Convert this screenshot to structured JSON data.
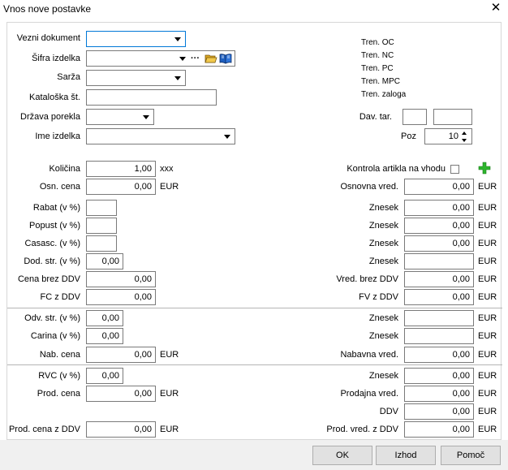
{
  "window": {
    "title": "Vnos nove postavke"
  },
  "header": {
    "vezni_dokument": "Vezni dokument",
    "sifra_izdelka": "Šifra izdelka",
    "sarza": "Sarža",
    "kataloska": "Kataloška št.",
    "drzava": "Država porekla",
    "ime_izdelka": "Ime izdelka",
    "tren_oc": "Tren. OC",
    "tren_nc": "Tren. NC",
    "tren_pc": "Tren. PC",
    "tren_mpc": "Tren. MPC",
    "tren_zaloga": "Tren. zaloga",
    "dav_tar": "Dav. tar.",
    "poz": "Poz",
    "poz_value": "10",
    "dots": "···"
  },
  "main": {
    "kolicina": "Količina",
    "kolicina_value": "1,00",
    "kolicina_unit": "xxx",
    "kontrola": "Kontrola artikla na vhodu",
    "osn_cena": "Osn. cena",
    "osn_cena_value": "0,00",
    "osnovna_vred": "Osnovna vred.",
    "osnovna_vred_value": "0,00",
    "rabat": "Rabat (v %)",
    "popust": "Popust (v %)",
    "casasc": "Casasc. (v %)",
    "dod_str": "Dod. str. (v %)",
    "dod_str_value": "0,00",
    "znesek": "Znesek",
    "znesek_value": "0,00",
    "cena_brez_ddv": "Cena brez DDV",
    "cena_brez_ddv_value": "0,00",
    "vred_brez_ddv": "Vred. brez DDV",
    "vred_brez_ddv_value": "0,00",
    "fc_z_ddv": "FC z DDV",
    "fc_z_ddv_value": "0,00",
    "fv_z_ddv": "FV z DDV",
    "fv_z_ddv_value": "0,00",
    "odv_str": "Odv. str. (v %)",
    "odv_str_value": "0,00",
    "carina": "Carina (v %)",
    "carina_value": "0,00",
    "nab_cena": "Nab. cena",
    "nab_cena_value": "0,00",
    "nabavna_vred": "Nabavna vred.",
    "nabavna_vred_value": "0,00",
    "rvc": "RVC (v %)",
    "rvc_value": "0,00",
    "prod_cena": "Prod. cena",
    "prod_cena_value": "0,00",
    "prodajna_vred": "Prodajna vred.",
    "prodajna_vred_value": "0,00",
    "ddv": "DDV",
    "ddv_value": "0,00",
    "prod_cena_z_ddv": "Prod. cena z DDV",
    "prod_cena_z_ddv_value": "0,00",
    "prod_vred_z_ddv": "Prod. vred. z DDV",
    "prod_vred_z_ddv_value": "0,00",
    "currency": "EUR"
  },
  "buttons": {
    "ok": "OK",
    "izhod": "Izhod",
    "pomoc": "Pomoč"
  },
  "icons": {
    "folder": "folder-open-icon",
    "book": "book-icon",
    "plus": "plus-icon",
    "close": "close-icon"
  },
  "colors": {
    "accent": "#0078d7",
    "plus": "#2db52d"
  }
}
